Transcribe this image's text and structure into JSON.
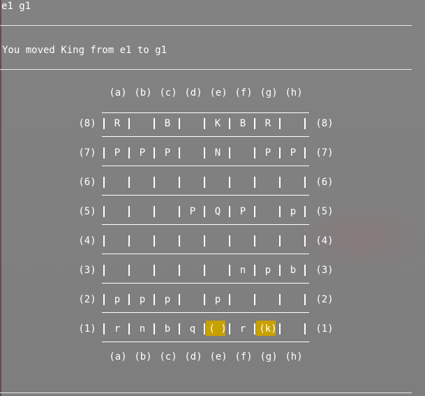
{
  "terminal": {
    "command": "e1 g1",
    "message": "You moved King from e1 to g1"
  },
  "board": {
    "file_labels": [
      "(a)",
      "(b)",
      "(c)",
      "(d)",
      "(e)",
      "(f)",
      "(g)",
      "(h)"
    ],
    "ranks": [
      {
        "label": "(8)",
        "cells": [
          "R",
          "",
          "B",
          "",
          "K",
          "B",
          "R",
          ""
        ]
      },
      {
        "label": "(7)",
        "cells": [
          "P",
          "P",
          "P",
          "",
          "N",
          "",
          "P",
          "P"
        ]
      },
      {
        "label": "(6)",
        "cells": [
          "",
          "",
          "",
          "",
          "",
          "",
          "",
          ""
        ]
      },
      {
        "label": "(5)",
        "cells": [
          "",
          "",
          "",
          "P",
          "Q",
          "P",
          "",
          "p"
        ]
      },
      {
        "label": "(4)",
        "cells": [
          "",
          "",
          "",
          "",
          "",
          "",
          "",
          ""
        ]
      },
      {
        "label": "(3)",
        "cells": [
          "",
          "",
          "",
          "",
          "",
          "n",
          "p",
          "b"
        ]
      },
      {
        "label": "(2)",
        "cells": [
          "p",
          "p",
          "p",
          "",
          "p",
          "",
          "",
          ""
        ]
      },
      {
        "label": "(1)",
        "cells": [
          "r",
          "n",
          "b",
          "q",
          "( )",
          "r",
          "(k)",
          ""
        ]
      }
    ],
    "highlight_color": "#c8a000"
  }
}
